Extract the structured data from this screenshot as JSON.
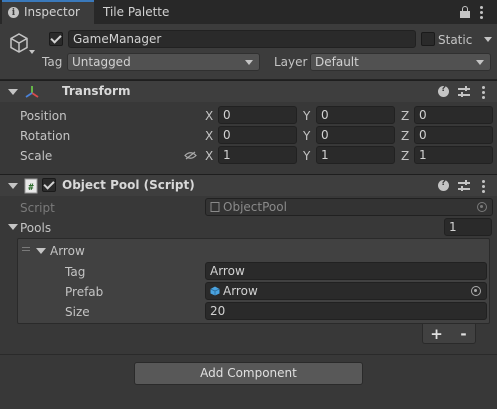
{
  "tabs": [
    {
      "label": "Inspector"
    },
    {
      "label": "Tile Palette"
    }
  ],
  "gameobject": {
    "active": true,
    "name": "GameManager",
    "static_label": "Static",
    "static_checked": false,
    "tag_label": "Tag",
    "tag_value": "Untagged",
    "layer_label": "Layer",
    "layer_value": "Default"
  },
  "transform": {
    "title": "Transform",
    "position_label": "Position",
    "rotation_label": "Rotation",
    "scale_label": "Scale",
    "position": {
      "x": "0",
      "y": "0",
      "z": "0"
    },
    "rotation": {
      "x": "0",
      "y": "0",
      "z": "0"
    },
    "scale": {
      "x": "1",
      "y": "1",
      "z": "1"
    },
    "axis_x": "X",
    "axis_y": "Y",
    "axis_z": "Z"
  },
  "object_pool": {
    "title": "Object Pool (Script)",
    "script_label": "Script",
    "script_value": "ObjectPool",
    "pools_label": "Pools",
    "pools_count": "1",
    "element": {
      "name": "Arrow",
      "tag_label": "Tag",
      "tag_value": "Arrow",
      "prefab_label": "Prefab",
      "prefab_value": "Arrow",
      "size_label": "Size",
      "size_value": "20"
    },
    "add_label": "+",
    "remove_label": "-"
  },
  "add_component_label": "Add Component",
  "colors": {
    "accent": "#3a79bb",
    "background": "#383838",
    "field": "#2a2a2a"
  }
}
